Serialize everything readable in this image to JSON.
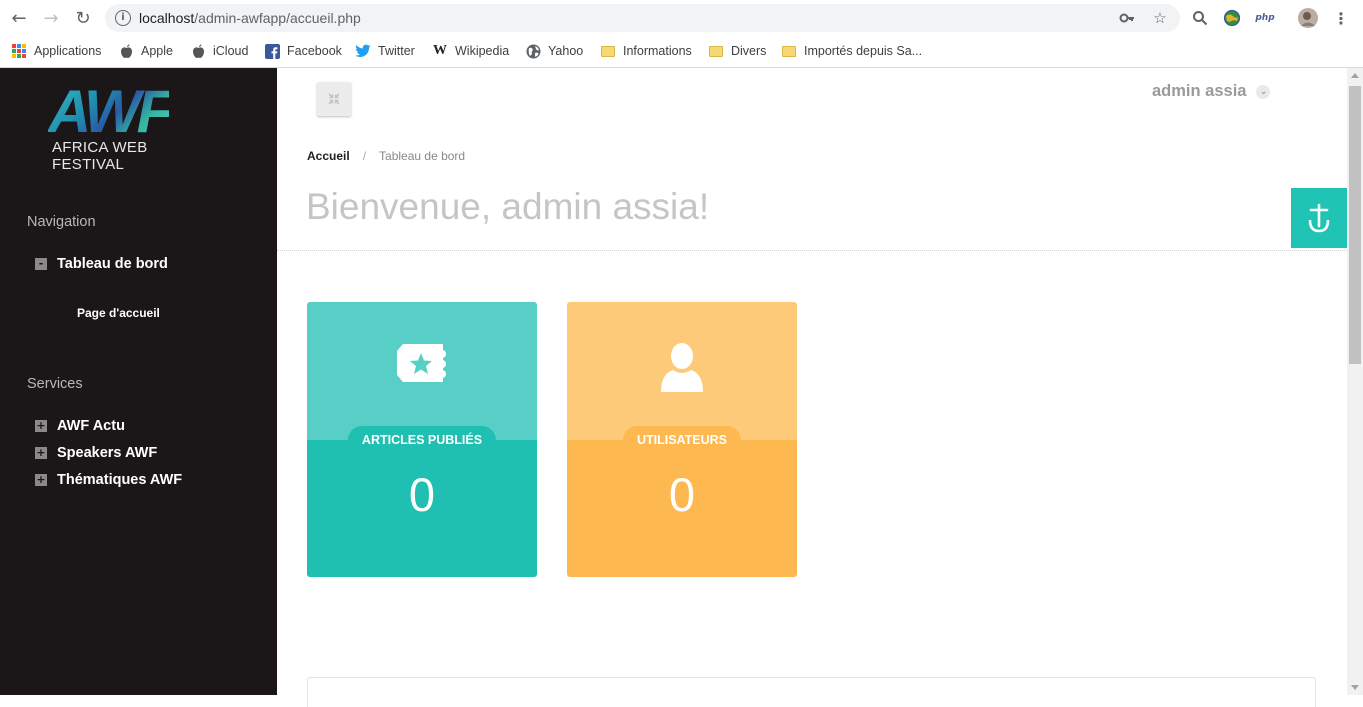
{
  "browser": {
    "url_host": "localhost",
    "url_path": "/admin-awfapp/accueil.php",
    "ext_php_label": "php"
  },
  "bookmarks": [
    {
      "label": "Applications",
      "icon": "apps-grid-icon"
    },
    {
      "label": "Apple",
      "icon": "apple-icon"
    },
    {
      "label": "iCloud",
      "icon": "apple-icon"
    },
    {
      "label": "Facebook",
      "icon": "facebook-icon"
    },
    {
      "label": "Twitter",
      "icon": "twitter-icon"
    },
    {
      "label": "Wikipedia",
      "icon": "wikipedia-icon"
    },
    {
      "label": "Yahoo",
      "icon": "globe-icon"
    },
    {
      "label": "Informations",
      "icon": "folder-icon"
    },
    {
      "label": "Divers",
      "icon": "folder-icon"
    },
    {
      "label": "Importés depuis Sa...",
      "icon": "folder-icon"
    }
  ],
  "sidebar": {
    "logo_letters": "AWF",
    "logo_subtitle": "AFRICA WEB FESTIVAL",
    "nav_heading": "Navigation",
    "dashboard": {
      "toggle": "-",
      "label": "Tableau de bord"
    },
    "dashboard_sub": "Page d'accueil",
    "services_heading": "Services",
    "services": [
      {
        "toggle": "+",
        "label": "AWF Actu"
      },
      {
        "toggle": "+",
        "label": "Speakers AWF"
      },
      {
        "toggle": "+",
        "label": "Thématiques AWF"
      }
    ]
  },
  "header": {
    "user_name": "admin assia"
  },
  "breadcrumb": {
    "home": "Accueil",
    "separator": "/",
    "current": "Tableau de bord"
  },
  "page_title": "Bienvenue, admin assia!",
  "cards": [
    {
      "label": "ARTICLES PUBLIÉS",
      "count": "0",
      "icon": "ticket-star-icon",
      "color_top": "#58cfc6",
      "color_bottom": "#1fbfb2"
    },
    {
      "label": "UTILISATEURS",
      "count": "0",
      "icon": "user-icon",
      "color_top": "#fdca7a",
      "color_bottom": "#fdb94f"
    }
  ],
  "colors": {
    "sidebar_bg": "#1b1617",
    "accent_teal": "#20c4b5",
    "accent_orange": "#fdb94f"
  }
}
